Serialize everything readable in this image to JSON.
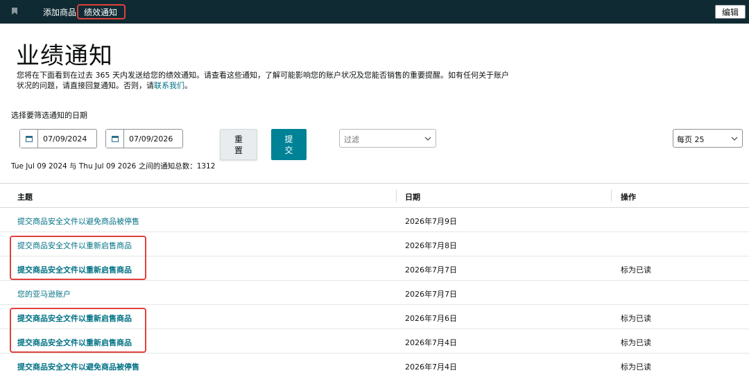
{
  "topnav": {
    "add_product": "添加商品",
    "performance_notifications": "绩效通知",
    "edit_label": "编辑"
  },
  "header": {
    "title": "业绩通知",
    "intro_line1": "您将在下面看到在过去 365 天内发送给您的绩效通知。请查看这些通知，了解可能影响您的账户状况及您能否销售的重要提醒。如有任何关于账户",
    "intro_line2_prefix": "状况的问题，请直接回复通知。否则，请",
    "contact_link": "联系我们",
    "intro_line2_suffix": "。"
  },
  "filters": {
    "date_label": "选择要筛选通知的日期",
    "date_from": "07/09/2024",
    "date_to": "07/09/2026",
    "reset_label": "重置",
    "submit_label": "提交",
    "filter_placeholder": "过滤",
    "per_page": "每页 25",
    "total_text": "Tue Jul 09 2024 与 Thu Jul 09 2026 之间的通知总数：1312"
  },
  "table": {
    "columns": [
      "主题",
      "日期",
      "操作"
    ],
    "rows": [
      {
        "subject": "提交商品安全文件以避免商品被停售",
        "date": "2026年7月9日",
        "action": ""
      },
      {
        "subject": "提交商品安全文件以重新启售商品",
        "date": "2026年7月8日",
        "action": ""
      },
      {
        "subject": "提交商品安全文件以重新启售商品",
        "date": "2026年7月7日",
        "action": "标为已读"
      },
      {
        "subject": "您的亚马逊账户",
        "date": "2026年7月7日",
        "action": ""
      },
      {
        "subject": "提交商品安全文件以重新启售商品",
        "date": "2026年7月6日",
        "action": "标为已读"
      },
      {
        "subject": "提交商品安全文件以重新启售商品",
        "date": "2026年7月4日",
        "action": "标为已读"
      },
      {
        "subject": "提交商品安全文件以避免商品被停售",
        "date": "2026年7月4日",
        "action": "标为已读"
      }
    ]
  },
  "colors": {
    "topbar": "#0f2a33",
    "link": "#007185",
    "submit": "#008296",
    "highlight": "#e0413c"
  },
  "icons": {
    "nav": "bookmark-icon",
    "date": "calendar-icon",
    "dropdown": "chevron-down-icon"
  }
}
